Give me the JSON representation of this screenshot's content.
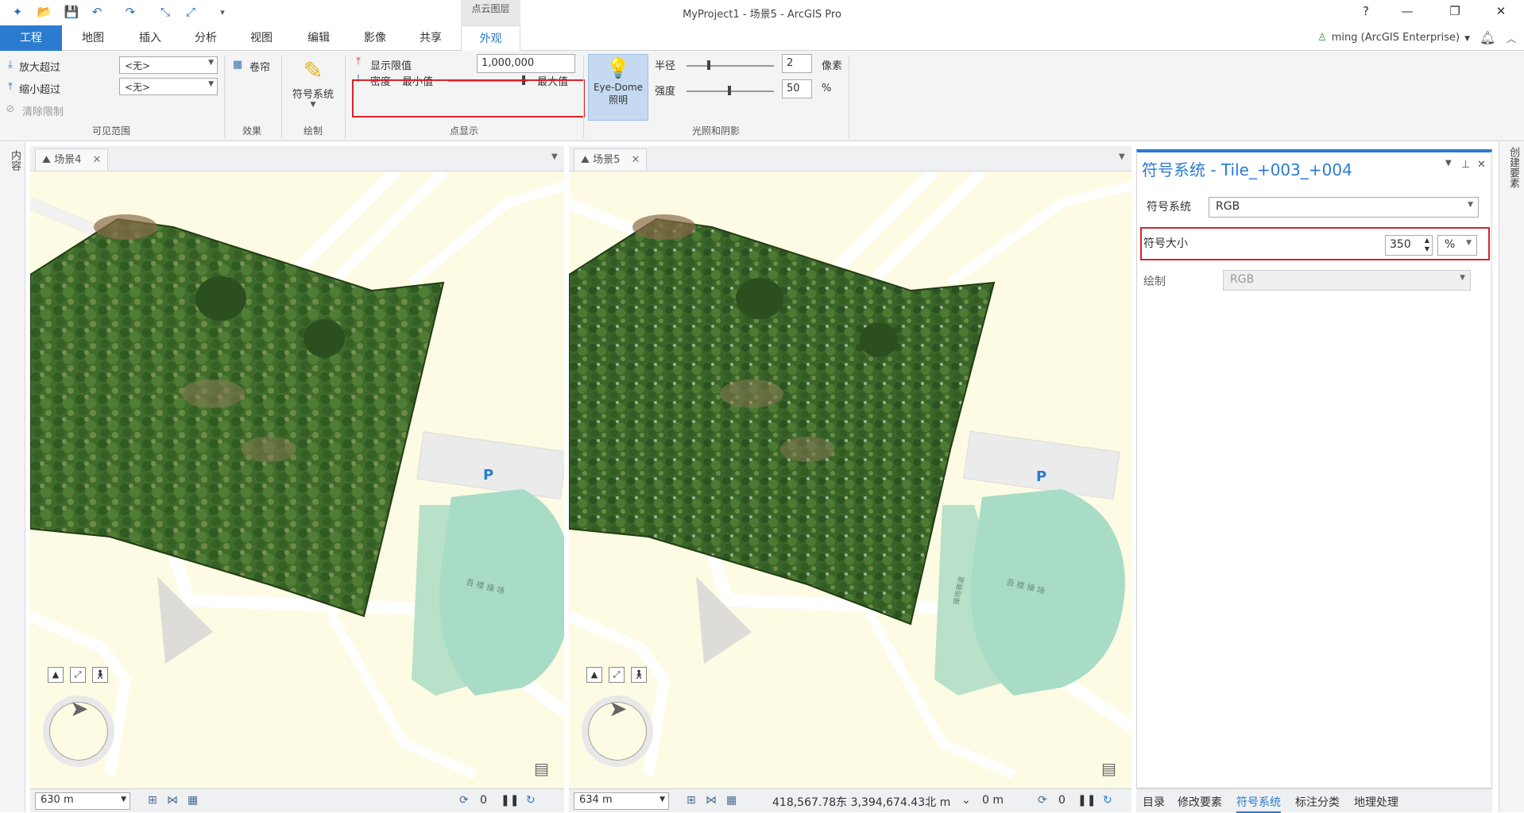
{
  "app": {
    "title": "MyProject1 - 场景5 - ArcGIS Pro",
    "contextual_tab_header": "点云图层",
    "help_label": "?"
  },
  "tabs": [
    {
      "label": "工程"
    },
    {
      "label": "地图"
    },
    {
      "label": "插入"
    },
    {
      "label": "分析"
    },
    {
      "label": "视图"
    },
    {
      "label": "编辑"
    },
    {
      "label": "影像"
    },
    {
      "label": "共享"
    },
    {
      "label": "外观"
    }
  ],
  "user": {
    "name": "ming (ArcGIS Enterprise)"
  },
  "ribbon": {
    "visible_range": {
      "zoom_in_beyond": "放大超过",
      "zoom_out_beyond": "缩小超过",
      "clear_limits": "清除限制",
      "zoom_in_value": "<无>",
      "zoom_out_value": "<无>",
      "group_label": "可见范围"
    },
    "effects": {
      "swipe_label": "卷帘",
      "group_label": "效果"
    },
    "drawing": {
      "symbology_label": "符号系统",
      "group_label": "绘制"
    },
    "point_display": {
      "display_limit_label": "显示限值",
      "display_limit_value": "1,000,000",
      "density_label": "密度",
      "min_label": "最小值",
      "max_label": "最大值",
      "density_level": 0.95,
      "group_label": "点显示"
    },
    "lighting": {
      "edl_label_line1": "Eye-Dome",
      "edl_label_line2": "照明",
      "radius_label": "半径",
      "radius_value": "2",
      "radius_unit": "像素",
      "strength_label": "强度",
      "strength_value": "50",
      "strength_unit": "%",
      "group_label": "光照和阴影"
    }
  },
  "left_strip": {
    "label": "内容"
  },
  "right_strip": {
    "label": "创建要素"
  },
  "views": [
    {
      "tab_label": "场景4",
      "scale": "630 m",
      "status_count": "0"
    },
    {
      "tab_label": "场景5",
      "scale": "634 m",
      "coordinates": "418,567.78东 3,394,674.43北 m",
      "elevation": "0 m",
      "status_count": "0"
    }
  ],
  "map_labels": {
    "parking": "P",
    "stadium": "吾 楼 操 场",
    "track": "操场赛道"
  },
  "symbology_pane": {
    "title": "符号系统 -  Tile_+003_+004",
    "symbology_label": "符号系统",
    "symbology_value": "RGB",
    "symbol_size_label": "符号大小",
    "symbol_size_value": "350",
    "symbol_size_unit": "%",
    "draw_label": "绘制",
    "draw_value": "RGB"
  },
  "bottom_tabs": [
    {
      "label": "目录"
    },
    {
      "label": "修改要素"
    },
    {
      "label": "符号系统"
    },
    {
      "label": "标注分类"
    },
    {
      "label": "地理处理"
    }
  ],
  "colors": {
    "accent": "#2b7bd1",
    "highlight_box": "#d8232a",
    "map_background": "#fdfbe3",
    "stadium_green": "#a8dcc6",
    "vegetation": "#3d6b2a"
  }
}
